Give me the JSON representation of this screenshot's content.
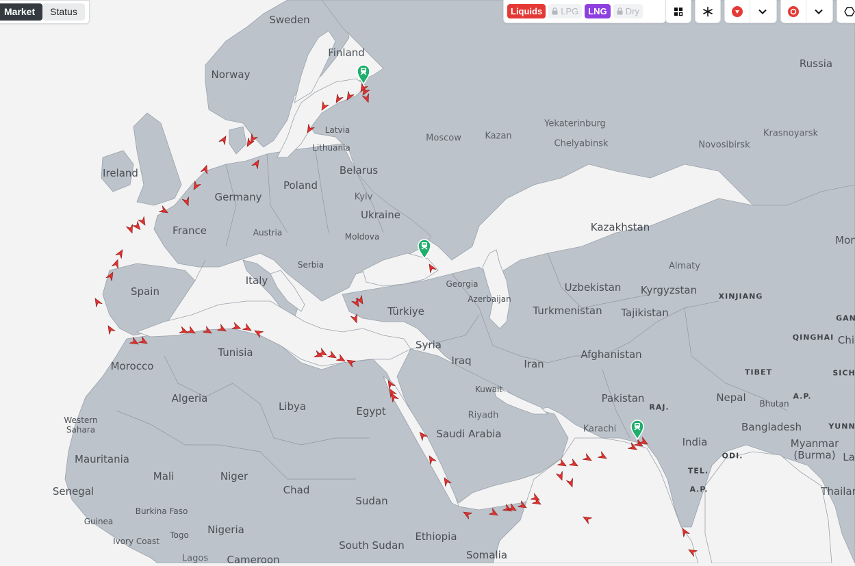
{
  "view_toggle": {
    "market": "Market",
    "status": "Status"
  },
  "filters": {
    "liquids": "Liquids",
    "lpg": "LPG",
    "lng": "LNG",
    "dry": "Dry"
  },
  "toolbar_icons": [
    "grid-icon",
    "sparkle-icon",
    "vessel-marker-icon",
    "chevron-down-icon",
    "terminal-marker-icon",
    "chevron-down-icon",
    "hexagon-icon"
  ],
  "colors": {
    "liquids": "#e53935",
    "lng": "#8e3fe0",
    "vessel": "#e0322f",
    "terminal": "#1fae6b",
    "land": "#bcc3cb",
    "water": "#f3f3f3"
  },
  "map_labels": {
    "sweden": "Sweden",
    "finland": "Finland",
    "norway": "Norway",
    "russia": "Russia",
    "latvia": "Latvia",
    "lithuania": "Lithuania",
    "moscow": "Moscow",
    "kazan": "Kazan",
    "yekaterinburg": "Yekaterinburg",
    "chelyabinsk": "Chelyabinsk",
    "novosibirsk": "Novosibirsk",
    "krasnoyarsk": "Krasnoyarsk",
    "ireland": "Ireland",
    "belarus": "Belarus",
    "poland": "Poland",
    "germany": "Germany",
    "kyiv": "Kyiv",
    "ukraine": "Ukraine",
    "france": "France",
    "austria": "Austria",
    "moldova": "Moldova",
    "kazakhstan": "Kazakhstan",
    "serbia": "Serbia",
    "spain": "Spain",
    "italy": "Italy",
    "georgia": "Georgia",
    "almaty": "Almaty",
    "uzbekistan": "Uzbekistan",
    "kyrgyzstan": "Kyrgyzstan",
    "azerbaijan": "Azerbaijan",
    "turkiye": "Türkiye",
    "turkmenistan": "Turkmenistan",
    "tajikistan": "Tajikistan",
    "xinjiang": "XINJIANG",
    "tunisia": "Tunisia",
    "syria": "Syria",
    "iraq": "Iraq",
    "iran": "Iran",
    "afghanistan": "Afghanistan",
    "qinghai": "QINGHAI",
    "morocco": "Morocco",
    "tibet": "TIBET",
    "algeria": "Algeria",
    "libya": "Libya",
    "egypt": "Egypt",
    "kuwait": "Kuwait",
    "pakistan": "Pakistan",
    "raj": "RAJ.",
    "nepal": "Nepal",
    "bhutan": "Bhutan",
    "western_sahara": "Western Sahara",
    "riyadh": "Riyadh",
    "saudi_arabia": "Saudi Arabia",
    "karachi": "Karachi",
    "bangladesh": "Bangladesh",
    "india": "India",
    "myanmar": "Myanmar (Burma)",
    "mauritania": "Mauritania",
    "odi": "ODI.",
    "mali": "Mali",
    "niger": "Niger",
    "tel": "TEL.",
    "senegal": "Senegal",
    "chad": "Chad",
    "ap": "A.P.",
    "sudan": "Sudan",
    "burkina_faso": "Burkina Faso",
    "guinea": "Guinea",
    "nigeria": "Nigeria",
    "togo": "Togo",
    "ethiopia": "Ethiopia",
    "ivory_coast": "Ivory Coast",
    "south_sudan": "South Sudan",
    "somalia": "Somalia",
    "lagos": "Lagos",
    "cameroon": "Cameroon",
    "mongolia_partial": "Mon",
    "china_partial": "Chi",
    "gan_partial": "GAN",
    "sich_partial": "SICH",
    "yunn_partial": "YUNN",
    "la_partial": "La",
    "thailand_partial": "Thailar",
    "ap2": "A.P."
  },
  "terminals": [
    "St Petersburg terminal",
    "Novorossiysk terminal",
    "Gujarat terminal"
  ]
}
